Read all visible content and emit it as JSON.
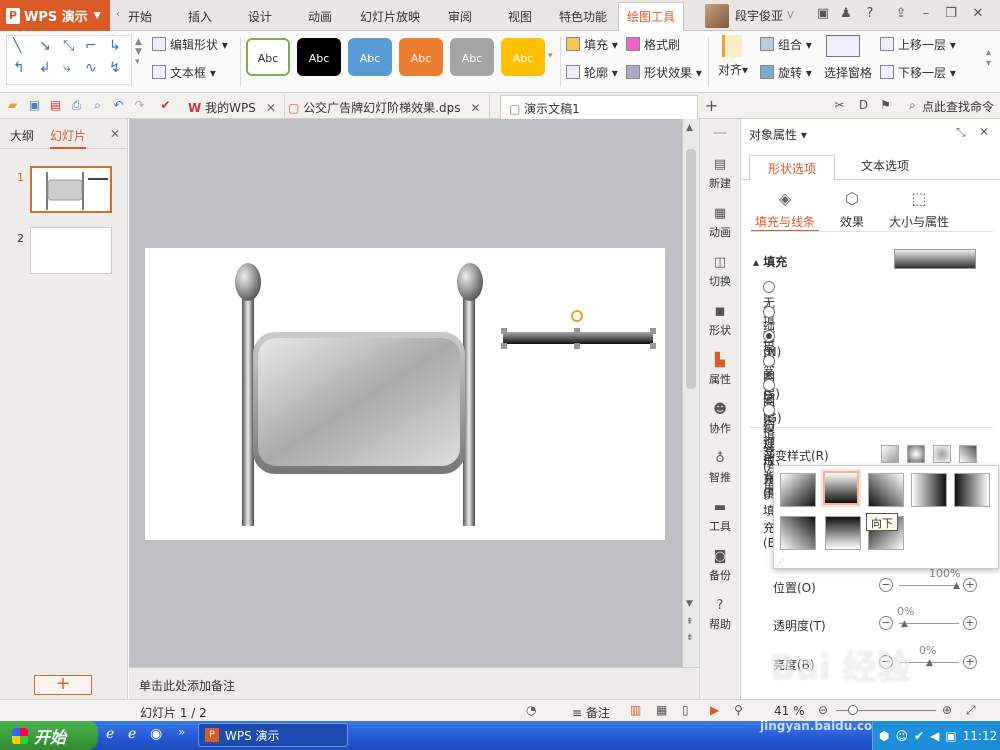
{
  "app": {
    "name": "WPS 演示",
    "logo_letter": "P"
  },
  "menu": {
    "tabs": [
      "开始",
      "插入",
      "设计",
      "动画",
      "幻灯片放映",
      "审阅",
      "视图",
      "特色功能",
      "绘图工具"
    ],
    "active_tab": "绘图工具",
    "user_name": "段宇俊亚"
  },
  "ribbon": {
    "edit_shape": "编辑形状",
    "textbox": "文本框",
    "style_label": "Abc",
    "styles": [
      {
        "bg": "#ffffff",
        "fg": "#333333",
        "border": "#7db04d"
      },
      {
        "bg": "#000000",
        "fg": "#ffffff",
        "border": "#000000"
      },
      {
        "bg": "#5b9bd5",
        "fg": "#ffffff",
        "border": "#5b9bd5"
      },
      {
        "bg": "#ed7d31",
        "fg": "#ffffff",
        "border": "#ed7d31"
      },
      {
        "bg": "#a5a5a5",
        "fg": "#ffffff",
        "border": "#a5a5a5"
      },
      {
        "bg": "#ffc000",
        "fg": "#ffffff",
        "border": "#ffc000"
      }
    ],
    "fill": "填充",
    "format_painter": "格式刷",
    "outline": "轮廓",
    "shape_effects": "形状效果",
    "align": "对齐",
    "group": "组合",
    "rotate": "旋转",
    "selection_pane": "选择窗格",
    "bring_forward": "上移一层",
    "send_backward": "下移一层"
  },
  "doc_tabs": [
    {
      "label": "我的WPS",
      "active": false
    },
    {
      "label": "公交广告牌幻灯阶梯效果.dps",
      "active": false
    },
    {
      "label": "演示文稿1 *",
      "active": true
    }
  ],
  "search_cmd": "点此查找命令",
  "left_panel": {
    "tab_outline": "大纲",
    "tab_slides": "幻灯片",
    "slides": [
      {
        "num": "1"
      },
      {
        "num": "2"
      }
    ]
  },
  "notes_placeholder": "单击此处添加备注",
  "right_column": [
    {
      "label": "新建",
      "icon": "new-icon"
    },
    {
      "label": "动画",
      "icon": "animation-icon"
    },
    {
      "label": "切换",
      "icon": "transition-icon"
    },
    {
      "label": "形状",
      "icon": "shape-icon"
    },
    {
      "label": "属性",
      "icon": "property-icon",
      "active": true
    },
    {
      "label": "协作",
      "icon": "collab-icon"
    },
    {
      "label": "智推",
      "icon": "smart-icon"
    },
    {
      "label": "工具",
      "icon": "tools-icon"
    },
    {
      "label": "备份",
      "icon": "backup-icon"
    },
    {
      "label": "帮助",
      "icon": "help-icon"
    }
  ],
  "pane": {
    "title": "对象属性",
    "tab_shape": "形状选项",
    "tab_text": "文本选项",
    "sub_fill_line": "填充与线条",
    "sub_effects": "效果",
    "sub_size": "大小与属性",
    "fill_heading": "填充",
    "fill_options": [
      "无填充(N)",
      "纯色填充(S)",
      "渐变填充(G)",
      "图片或纹理填充(P)",
      "图案填充(A)",
      "幻灯片背景填充(B)"
    ],
    "selected_fill": 2,
    "gradient_style": "渐变样式(R)",
    "angle_label_partial": "角",
    "position": {
      "label": "位置(O)",
      "value": "100%"
    },
    "transparency": {
      "label": "透明度(T)",
      "value": "0%"
    },
    "brightness": {
      "label": "亮度(B)",
      "value": "0%"
    },
    "tooltip": "向下"
  },
  "status": {
    "slide_info": "幻灯片 1 / 2",
    "notes_btn": "备注",
    "zoom": "41 %"
  },
  "taskbar": {
    "start": "开始",
    "task": "WPS 演示",
    "clock": "11:12"
  },
  "watermark": {
    "logo": "Bai 经验",
    "url": "jingyan.baidu.com"
  }
}
